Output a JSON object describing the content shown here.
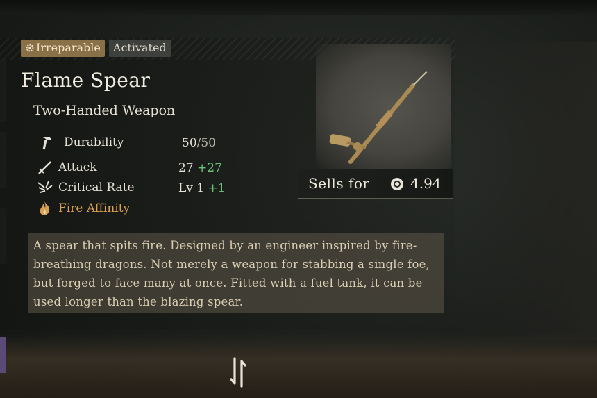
{
  "badges": {
    "irreparable": "Irreparable",
    "activated": "Activated"
  },
  "item": {
    "name": "Flame Spear",
    "type": "Two-Handed Weapon"
  },
  "stats": {
    "durability": {
      "label": "Durability",
      "current": "50",
      "max": "/50",
      "icon": "hammer-icon"
    },
    "attack": {
      "label": "Attack",
      "base": "27",
      "bonus": "+27",
      "icon": "sword-icon"
    },
    "critical_rate": {
      "label": "Critical Rate",
      "level": "Lv 1",
      "bonus": "+1",
      "icon": "crit-burst-icon"
    },
    "affinity": {
      "label": "Fire Affinity",
      "icon": "flame-icon"
    }
  },
  "sell": {
    "label": "Sells for",
    "value": "4.94",
    "icon": "coin-icon"
  },
  "description": "A spear that spits fire. Designed by an engineer inspired by fire-breathing dragons. Not merely a weapon for stabbing a single foe, but forged to face many at once. Fitted with a fuel tank, it can be used longer than the blazing spear.",
  "colors": {
    "bonus_green": "#6fc27c",
    "fire_orange": "#d8a052",
    "badge_gold": "#8a7046"
  }
}
